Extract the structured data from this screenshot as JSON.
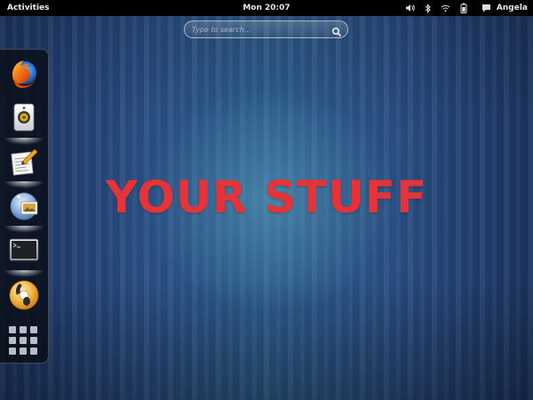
{
  "topbar": {
    "activities_label": "Activities",
    "clock": "Mon 20:07",
    "user_name": "Angela",
    "status_icons": [
      "volume-icon",
      "bluetooth-icon",
      "wifi-icon",
      "battery-icon",
      "chat-icon"
    ]
  },
  "search": {
    "placeholder": "Type to search…",
    "icon": "search-icon"
  },
  "dash": {
    "favorites": [
      {
        "name": "firefox-icon",
        "running": false
      },
      {
        "name": "rhythmbox-speaker-icon",
        "running": true
      },
      {
        "name": "text-editor-icon",
        "running": true
      },
      {
        "name": "shotwell-icon",
        "running": true
      },
      {
        "name": "terminal-icon",
        "running": true
      },
      {
        "name": "sound-juicer-icon",
        "running": false
      }
    ],
    "show_apps_icon": "show-applications-grid-icon"
  },
  "overlay_text": "YOUR STUFF",
  "colors": {
    "overlay_text": "#e4343a",
    "topbar": "#000000",
    "background": "#2a4d82"
  }
}
